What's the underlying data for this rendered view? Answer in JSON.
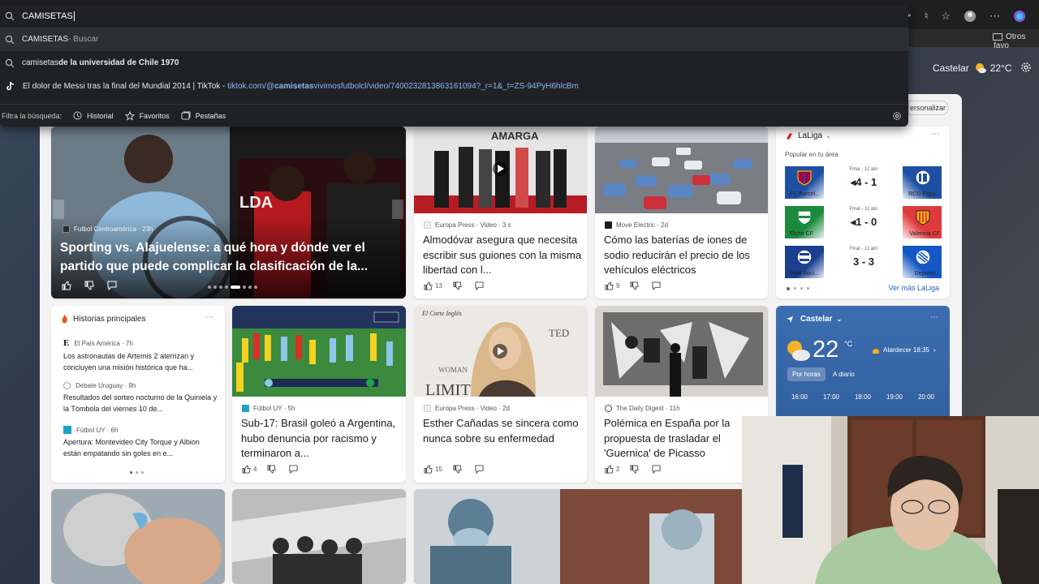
{
  "omnibox": {
    "query": "CAMISETAS",
    "suggestions": [
      {
        "bold": "CAMISETAS",
        "dim": " - Buscar"
      },
      {
        "normal": "camisetas",
        "bold": " de la universidad de Chile 1970"
      },
      {
        "normal": "El dolor de Messi tras la final del Mundial 2014 | TikTok",
        "link_pre": "tiktok.com/@",
        "link_bold": "camisetas",
        "link_post": "vivimosfutbolcl/video/7400232813863161094?_r=1&_t=ZS-94PyH6hlcBm"
      }
    ],
    "filter_label": "Filtra la búsqueda:",
    "filters": [
      "Historial",
      "Favoritos",
      "Pestañas"
    ]
  },
  "favorites_bar": {
    "other": "Otros favo"
  },
  "header": {
    "location": "Castelar",
    "temp": "22°C",
    "personalize": "ersonalizar"
  },
  "hero": {
    "source": "Futbol Centroamérica",
    "age": "23h",
    "title": "Sporting vs. Alajuelense: a qué hora y dónde ver el partido que puede complicar la clasificación de la..."
  },
  "cards_row1": [
    {
      "source": "Europa Press · Video · 3 s",
      "title": "Almodóvar asegura que necesita escribir sus guiones con la misma libertad con l...",
      "likes": "13"
    },
    {
      "source": "Move Electric · 2d",
      "title": "Cómo las baterías de iones de sodio reducirán el precio de los vehículos eléctricos",
      "likes": "9"
    }
  ],
  "sports": {
    "league": "LaLiga",
    "subtitle": "Popular en tu área",
    "more": "Ver más LaLiga",
    "matches": [
      {
        "final": "Final - 11 abr",
        "home": "FC Barcel...",
        "away": "RCD Espa...",
        "score": "4 - 1",
        "home_color": "#a50044",
        "away_color": "#1f4fa3"
      },
      {
        "final": "Final - 11 abr",
        "home": "Elche CF",
        "away": "Valencia CF",
        "score": "1 - 0",
        "home_color": "#1c8a3d",
        "away_color": "#e03a3e"
      },
      {
        "final": "Final - 11 abr",
        "home": "Real Soci...",
        "away": "Deportiv...",
        "score": "3 - 3",
        "home_color": "#1a3f8f",
        "away_color": "#1456c3"
      }
    ]
  },
  "top_stories": {
    "title": "Historias principales",
    "items": [
      {
        "source": "El País América · 7h",
        "text": "Los astronautas de Artemis 2 aterrizan y concluyen una misión histórica que ha..."
      },
      {
        "source": "Debate Uruguay · 9h",
        "text": "Resultados del sorteo nocturno de la Quiniela y la Tómbola del viernes 10 de..."
      },
      {
        "source": "Fútbol UY · 6h",
        "text": "Apertura: Montevideo City Torque y Albion están empatando sin goles en e..."
      }
    ]
  },
  "cards_row2": [
    {
      "source": "Fútbol UY · 5h",
      "title": "Sub-17: Brasil goleó a Argentina, hubo denuncia por racismo y terminaron a...",
      "likes": "4"
    },
    {
      "source": "Europa Press · Video · 2d",
      "title": "Esther Cañadas se sincera como nunca sobre su enfermedad",
      "likes": "15"
    },
    {
      "source": "The Daily Digest · 11h",
      "title": "Polémica en España por la propuesta de trasladar el 'Guernica' de Picasso",
      "likes": "2"
    }
  ],
  "weather": {
    "location": "Castelar",
    "temp": "22",
    "unit": "°C",
    "sunset": "Atardecer 18:35",
    "tabs": [
      "Por horas",
      "A diario"
    ],
    "hours": [
      "16:00",
      "17:00",
      "18:00",
      "19:00",
      "20:00"
    ]
  },
  "images": {
    "amarga_text": "AMARGA",
    "lda_text": "LDA",
    "woman_text": "WOMAN",
    "limite_text": "LIMITE",
    "ted_text": "TED",
    "corte_text": "El Corte Inglés"
  }
}
